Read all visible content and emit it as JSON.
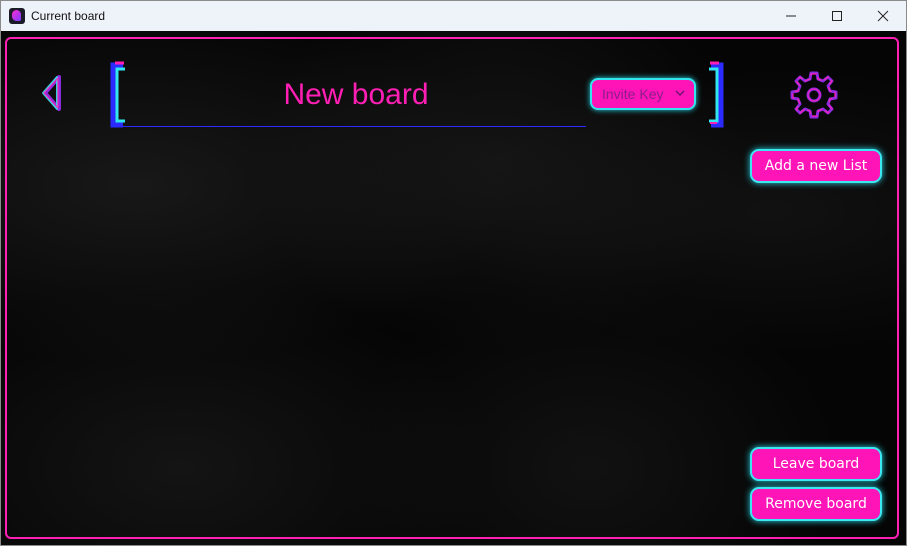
{
  "window": {
    "title": "Current board",
    "minimize_glyph": "—",
    "maximize_glyph": "☐",
    "close_glyph": "✕"
  },
  "board": {
    "title": "New board"
  },
  "invite": {
    "selected": "Invite Key",
    "chevron": "⌄"
  },
  "actions": {
    "add_list": "Add a new List",
    "leave_board": "Leave board",
    "remove_board": "Remove board"
  },
  "icons": {
    "back": "back-arrow-icon",
    "settings": "gear-icon",
    "app": "app-icon"
  },
  "colors": {
    "accent_pink": "#ff14b8",
    "accent_cyan": "#32e6ee",
    "accent_purple": "#8a2be2",
    "underline_blue": "#2b2bff",
    "background": "#050505"
  }
}
